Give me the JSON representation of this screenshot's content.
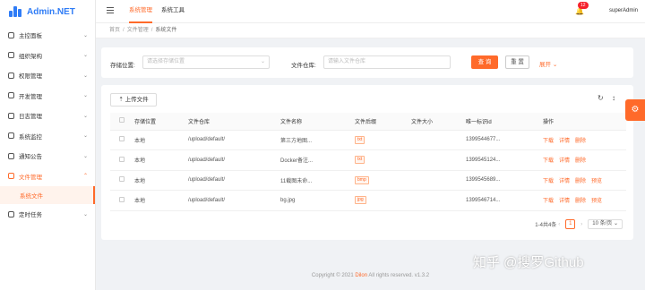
{
  "app": {
    "title": "Admin.NET"
  },
  "sidebar": {
    "items": [
      {
        "label": "主控面板"
      },
      {
        "label": "组织架构"
      },
      {
        "label": "权限管理"
      },
      {
        "label": "开发管理"
      },
      {
        "label": "日志管理"
      },
      {
        "label": "系统监控"
      },
      {
        "label": "通知公告"
      },
      {
        "label": "文件管理"
      }
    ],
    "subitem": "系统文件",
    "last": "定时任务"
  },
  "header": {
    "tabs": [
      {
        "label": "系统管理"
      },
      {
        "label": "系统工具"
      }
    ],
    "badge": "12",
    "user": "superAdmin"
  },
  "breadcrumb": {
    "home": "首页",
    "parent": "文件管理",
    "current": "系统文件"
  },
  "search": {
    "storage_label": "存储位置:",
    "storage_placeholder": "请选择存储位置",
    "bucket_label": "文件仓库:",
    "bucket_placeholder": "请输入文件仓库",
    "query_label": "查 询",
    "reset_label": "重 置",
    "expand_label": "展开"
  },
  "toolbar": {
    "upload_label": "上传文件"
  },
  "table": {
    "headers": [
      "存储位置",
      "文件仓库",
      "文件名称",
      "文件后缀",
      "文件大小",
      "唯一标识id",
      "操作"
    ],
    "rows": [
      {
        "loc": "本地",
        "bucket": "/upload/default/",
        "name": "第三方地图...",
        "ext": "txt",
        "size": "",
        "id": "1399544677...",
        "actions": [
          "下载",
          "详情",
          "删除"
        ]
      },
      {
        "loc": "本地",
        "bucket": "/upload/default/",
        "name": "Docker备注...",
        "ext": "txt",
        "size": "",
        "id": "1399545124...",
        "actions": [
          "下载",
          "详情",
          "删除"
        ]
      },
      {
        "loc": "本地",
        "bucket": "/upload/default/",
        "name": "11截图未命...",
        "ext": "bmp",
        "size": "",
        "id": "1399545689...",
        "actions": [
          "下载",
          "详情",
          "删除",
          "预览"
        ]
      },
      {
        "loc": "本地",
        "bucket": "/upload/default/",
        "name": "bg.jpg",
        "ext": "jpg",
        "size": "",
        "id": "1399546714...",
        "actions": [
          "下载",
          "详情",
          "删除",
          "预览"
        ]
      }
    ]
  },
  "pagination": {
    "summary": "1-4共4条",
    "page": "1",
    "size": "10 条/页"
  },
  "footer": {
    "prefix": "Copyright © 2021 ",
    "brand": "Dilon",
    "suffix": " All rights reserved. v1.3.2"
  },
  "watermark": "知乎 @搜罗Github",
  "colors": {
    "accent": "#ff6a2a",
    "brand": "#2f7cf6"
  }
}
